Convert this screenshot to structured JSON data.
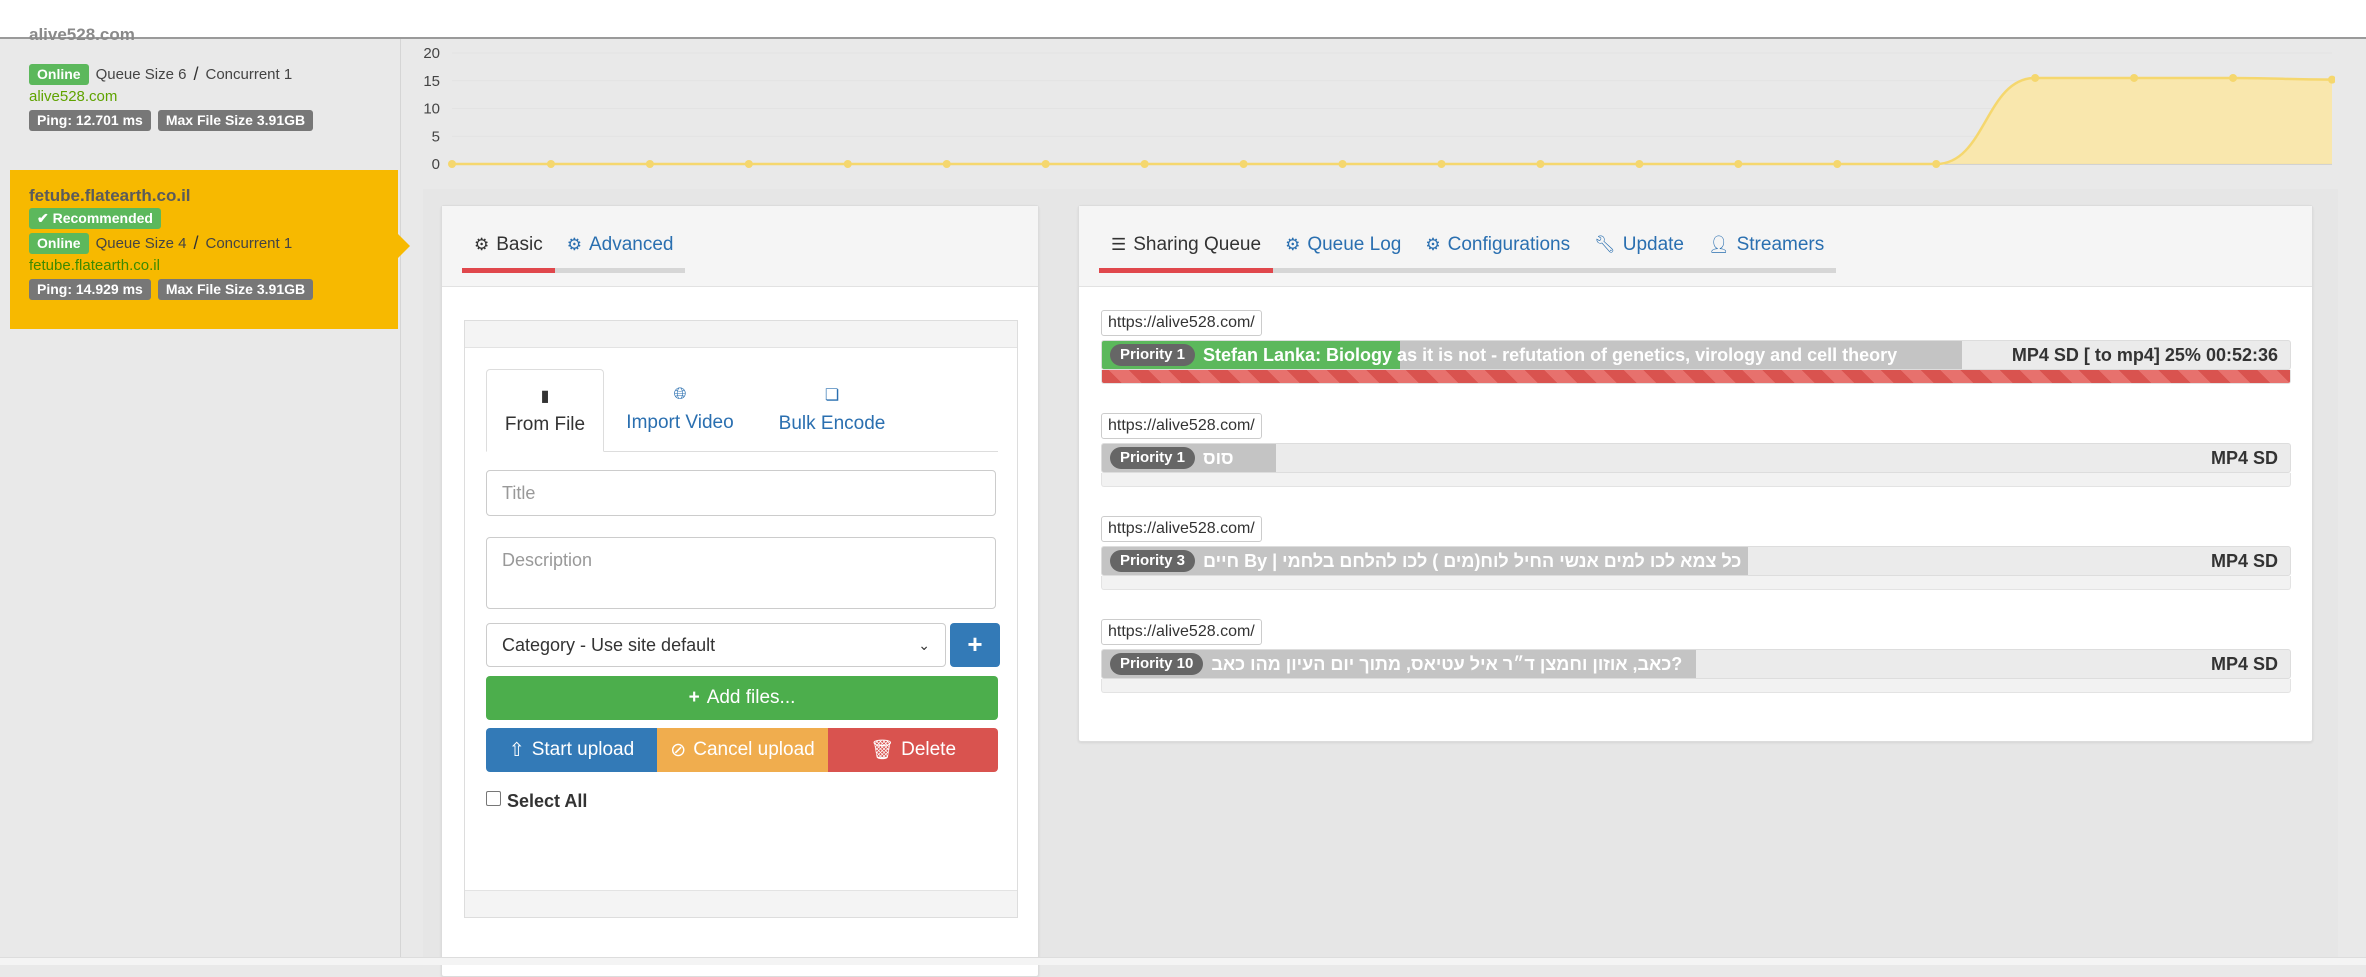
{
  "sidebar": {
    "servers": [
      {
        "name": "alive528.com",
        "status": "Online",
        "queue_size": "Queue Size 6",
        "separator": "/",
        "concurrent": "Concurrent 1",
        "link": "alive528.com",
        "ping": "Ping: 12.701 ms",
        "max_file": "Max File Size 3.91GB"
      },
      {
        "name": "fetube.flatearth.co.il",
        "recommended": "Recommended",
        "status": "Online",
        "queue_size": "Queue Size 4",
        "separator": "/",
        "concurrent": "Concurrent 1",
        "link": "fetube.flatearth.co.il",
        "ping": "Ping: 14.929 ms",
        "max_file": "Max File Size 3.91GB"
      }
    ]
  },
  "chart_data": {
    "type": "area",
    "y_ticks": [
      "20",
      "15",
      "10",
      "5",
      "0"
    ],
    "ylim": [
      0,
      20
    ],
    "values": [
      0,
      0,
      0,
      0,
      0,
      0,
      0,
      0,
      0,
      0,
      0,
      0,
      0,
      0,
      0,
      0,
      15.5,
      15.5,
      15.5,
      15.2
    ],
    "color": "#f5d76e"
  },
  "upload": {
    "tabs": [
      {
        "label": "Basic",
        "icon": "gear-icon"
      },
      {
        "label": "Advanced",
        "icon": "gears-icon"
      }
    ],
    "subtabs": [
      {
        "label": "From File",
        "icon": "file-icon"
      },
      {
        "label": "Import Video",
        "icon": "globe-icon"
      },
      {
        "label": "Bulk Encode",
        "icon": "files-icon"
      }
    ],
    "title_placeholder": "Title",
    "description_placeholder": "Description",
    "category_value": "Category - Use site default",
    "add_button": "Add files...",
    "start_button": "Start upload",
    "cancel_button": "Cancel upload",
    "delete_button": "Delete",
    "select_all": "Select All"
  },
  "queue": {
    "tabs": [
      {
        "label": "Sharing Queue",
        "icon": "server-icon"
      },
      {
        "label": "Queue Log",
        "icon": "gear-icon"
      },
      {
        "label": "Configurations",
        "icon": "gear-icon"
      },
      {
        "label": "Update",
        "icon": "wrench-icon"
      },
      {
        "label": "Streamers",
        "icon": "user-icon"
      }
    ],
    "items": [
      {
        "url": "https://alive528.com/",
        "priority": "Priority 1",
        "title": "Stefan Lanka: Biology as it is not - refutation of genetics, virology and cell theory",
        "format": "MP4 SD [ to mp4] 25% 00:52:36",
        "progress": 0.25
      },
      {
        "url": "https://alive528.com/",
        "priority": "Priority 1",
        "title": "סוס",
        "format": "MP4 SD"
      },
      {
        "url": "https://alive528.com/",
        "priority": "Priority 3",
        "title": "חיים By | כל צמא לכו למים אנשי החיל לוח(מים ) לכו להלחם בלחמי",
        "format": "MP4 SD"
      },
      {
        "url": "https://alive528.com/",
        "priority": "Priority 10",
        "title": "כאב, אוזון וחמצן ד״ר איל עטיאס, מתוך יום העיון מהו כאב?",
        "format": "MP4 SD"
      }
    ]
  }
}
